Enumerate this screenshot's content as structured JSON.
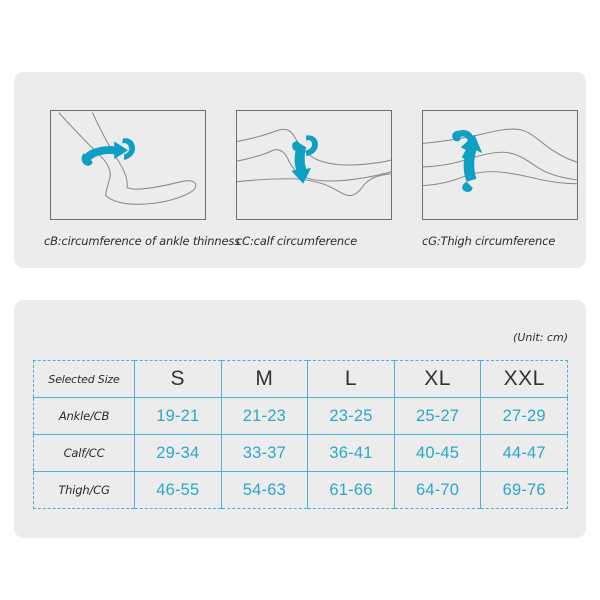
{
  "illustrations": {
    "figures": [
      {
        "icon": "ankle-measure-illustration",
        "caption": "cB:circumference of ankle thinness",
        "arrow": "wrap-arrow-right"
      },
      {
        "icon": "calf-measure-illustration",
        "caption": "cC:calf circumference",
        "arrow": "wrap-arrow-down"
      },
      {
        "icon": "thigh-measure-illustration",
        "caption": "cG:Thigh circumference",
        "arrow": "wrap-arrow-up"
      }
    ]
  },
  "size_chart": {
    "unit_note": "(Unit: cm)",
    "header": {
      "label": "Selected Size",
      "sizes": [
        "S",
        "M",
        "L",
        "XL",
        "XXL"
      ]
    },
    "rows": [
      {
        "label": "Ankle/CB",
        "values": [
          "19-21",
          "21-23",
          "23-25",
          "25-27",
          "27-29"
        ]
      },
      {
        "label": "Calf/CC",
        "values": [
          "29-34",
          "33-37",
          "36-41",
          "40-45",
          "44-47"
        ]
      },
      {
        "label": "Thigh/CG",
        "values": [
          "46-55",
          "54-63",
          "61-66",
          "64-70",
          "69-76"
        ]
      }
    ]
  },
  "colors": {
    "accent": "#2ba8c9",
    "arrow": "#0e9fc4",
    "card_bg": "#ececec",
    "line": "#6f6f6f",
    "text": "#2b2b2b",
    "page_bg": "#ffffff"
  }
}
